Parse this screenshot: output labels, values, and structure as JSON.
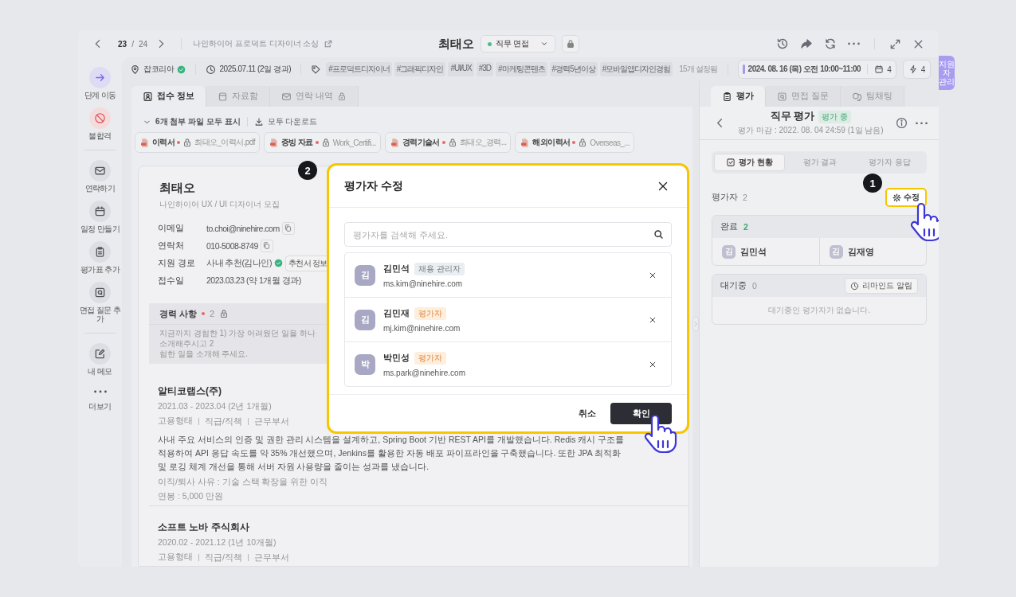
{
  "header": {
    "pager": {
      "current": "23",
      "separator": "/",
      "total": "24"
    },
    "project": "나인하이어 프로덕트 디자이너 소싱",
    "candidate": "최태오",
    "stage": "직무 면접"
  },
  "info_bar": {
    "source": "잡코리아",
    "source_verified": true,
    "date": "2025.07.11 (2일 경과)",
    "tags": [
      "#프로덕트디자이너",
      "#그래픽디자인",
      "#UI/UX",
      "#3D",
      "#마케팅콘텐츠",
      "#경력5년이상",
      "#모바일앱디자인경험"
    ],
    "tag_count": "15개 설정됨",
    "schedule": "2024. 08. 16 (목) 오전 10:00~11:00",
    "calendar_count": "4",
    "action_count": "4"
  },
  "sidebar": {
    "groups": [
      [
        {
          "label": "단계 이동",
          "kind": "primary"
        },
        {
          "label": "불합격",
          "kind": "danger"
        }
      ],
      [
        {
          "label": "연락하기",
          "kind": "default"
        },
        {
          "label": "일정 만들기",
          "kind": "default"
        },
        {
          "label": "평가표 추가",
          "kind": "default"
        },
        {
          "label": "면접 질문 추가",
          "kind": "default"
        }
      ],
      [
        {
          "label": "내 메모",
          "kind": "default"
        },
        {
          "label": "더보기",
          "kind": "plain"
        }
      ]
    ]
  },
  "left_tabs": [
    {
      "label": "접수 정보",
      "selected": true,
      "locked": false
    },
    {
      "label": "자료함",
      "selected": false,
      "locked": false
    },
    {
      "label": "연락 내역",
      "selected": false,
      "locked": true
    }
  ],
  "attachments": {
    "toggle": "6개 첨부 파일 모두 표시",
    "download": "모두 다운로드",
    "files": [
      {
        "label": "이력서",
        "required": true,
        "locked": true,
        "filename": "최태오_이력서.pdf"
      },
      {
        "label": "증빙 자료",
        "required": true,
        "locked": true,
        "filename": "Work_Certifi..."
      },
      {
        "label": "경력기술서",
        "required": true,
        "locked": true,
        "filename": "최태오_경력..."
      },
      {
        "label": "해외이력서",
        "required": true,
        "locked": true,
        "filename": "Overseas_..."
      }
    ]
  },
  "profile": {
    "name": "최태오",
    "posting": "나인하이어 UX / UI 디자이너 모집",
    "fields": [
      {
        "label": "이메일",
        "value": "to.choi@ninehire.com",
        "copyable": true,
        "verified": false
      },
      {
        "label": "연락처",
        "value": "010-5008-8749",
        "copyable": true,
        "verified": false
      },
      {
        "label": "지원 경로",
        "value": "사내 추천(김나인)",
        "copyable": false,
        "verified": true,
        "button": "추천서 정보"
      },
      {
        "label": "접수일",
        "value": "2023.03.23 (약 1개월 경과)",
        "copyable": false,
        "verified": false
      }
    ]
  },
  "career": {
    "title": "경력 사항",
    "required": true,
    "count": "2",
    "locked": true,
    "prompt_lines": [
      "지금까지 경험한 1) 가장 어려웠던 일을 하나 소개해주시고 2",
      "험한 일을 소개해 주세요."
    ],
    "experiences": [
      {
        "company": "알티코랩스(주)",
        "period": "2021.03 - 2023.04 (2년 1개월)",
        "meta": [
          "고용형태",
          "직급/직책",
          "근무부서"
        ],
        "description": "사내 주요 서비스의 인증 및 권한 관리 시스템을 설계하고, Spring Boot 기반 REST API를 개발했습니다. Redis 캐시 구조를 적용하여 API 응답 속도를 약 35% 개선했으며, Jenkins를 활용한 자동 배포 파이프라인을 구축했습니다. 또한 JPA 최적화 및 로깅 체계 개선을 통해 서버 자원 사용량을 줄이는 성과를 냈습니다.",
        "reason": "이직/퇴사 사유 : 기술 스택 확장을 위한 이직",
        "salary": "연봉 : 5,000 만원"
      },
      {
        "company": "소프트 노바 주식회사",
        "period": "2020.02 - 2021.12 (1년 10개월)",
        "meta": [
          "고용형태",
          "직급/직책",
          "근무부서"
        ]
      }
    ]
  },
  "right_panel": {
    "tabs": [
      {
        "label": "평가",
        "selected": true
      },
      {
        "label": "면접 질문",
        "selected": false
      },
      {
        "label": "팀채팅",
        "selected": false
      }
    ],
    "title": "직무 평가",
    "status": "평가 중",
    "deadline": "평가 마감 : 2022. 08. 04 24:59 (1일 남음)",
    "segments": [
      {
        "label": "평가 현황",
        "selected": true
      },
      {
        "label": "평가 결과",
        "selected": false
      },
      {
        "label": "평가자 응답",
        "selected": false
      }
    ],
    "evaluators_label": "평가자",
    "evaluators_count": "2",
    "edit": "수정",
    "completed": {
      "label": "완료",
      "count": "2",
      "people": [
        {
          "initial": "김",
          "name": "김민석"
        },
        {
          "initial": "김",
          "name": "김재영"
        }
      ]
    },
    "waiting": {
      "label": "대기중",
      "count": "0",
      "remind": "리마인드 알림",
      "empty": "대기중인 평가자가 없습니다."
    }
  },
  "modal": {
    "title": "평가자 수정",
    "search_placeholder": "평가자를 검색해 주세요.",
    "evaluators": [
      {
        "initial": "김",
        "name": "김민석",
        "role": "채용 관리자",
        "kind": "manager",
        "email": "ms.kim@ninehire.com"
      },
      {
        "initial": "김",
        "name": "김민재",
        "role": "평가자",
        "kind": "evaluator",
        "email": "mj.kim@ninehire.com"
      },
      {
        "initial": "박",
        "name": "박민성",
        "role": "평가자",
        "kind": "evaluator",
        "email": "ms.park@ninehire.com"
      }
    ],
    "cancel": "취소",
    "confirm": "확인"
  },
  "steps": [
    "1",
    "2"
  ],
  "side_tab": "지원자 관리"
}
